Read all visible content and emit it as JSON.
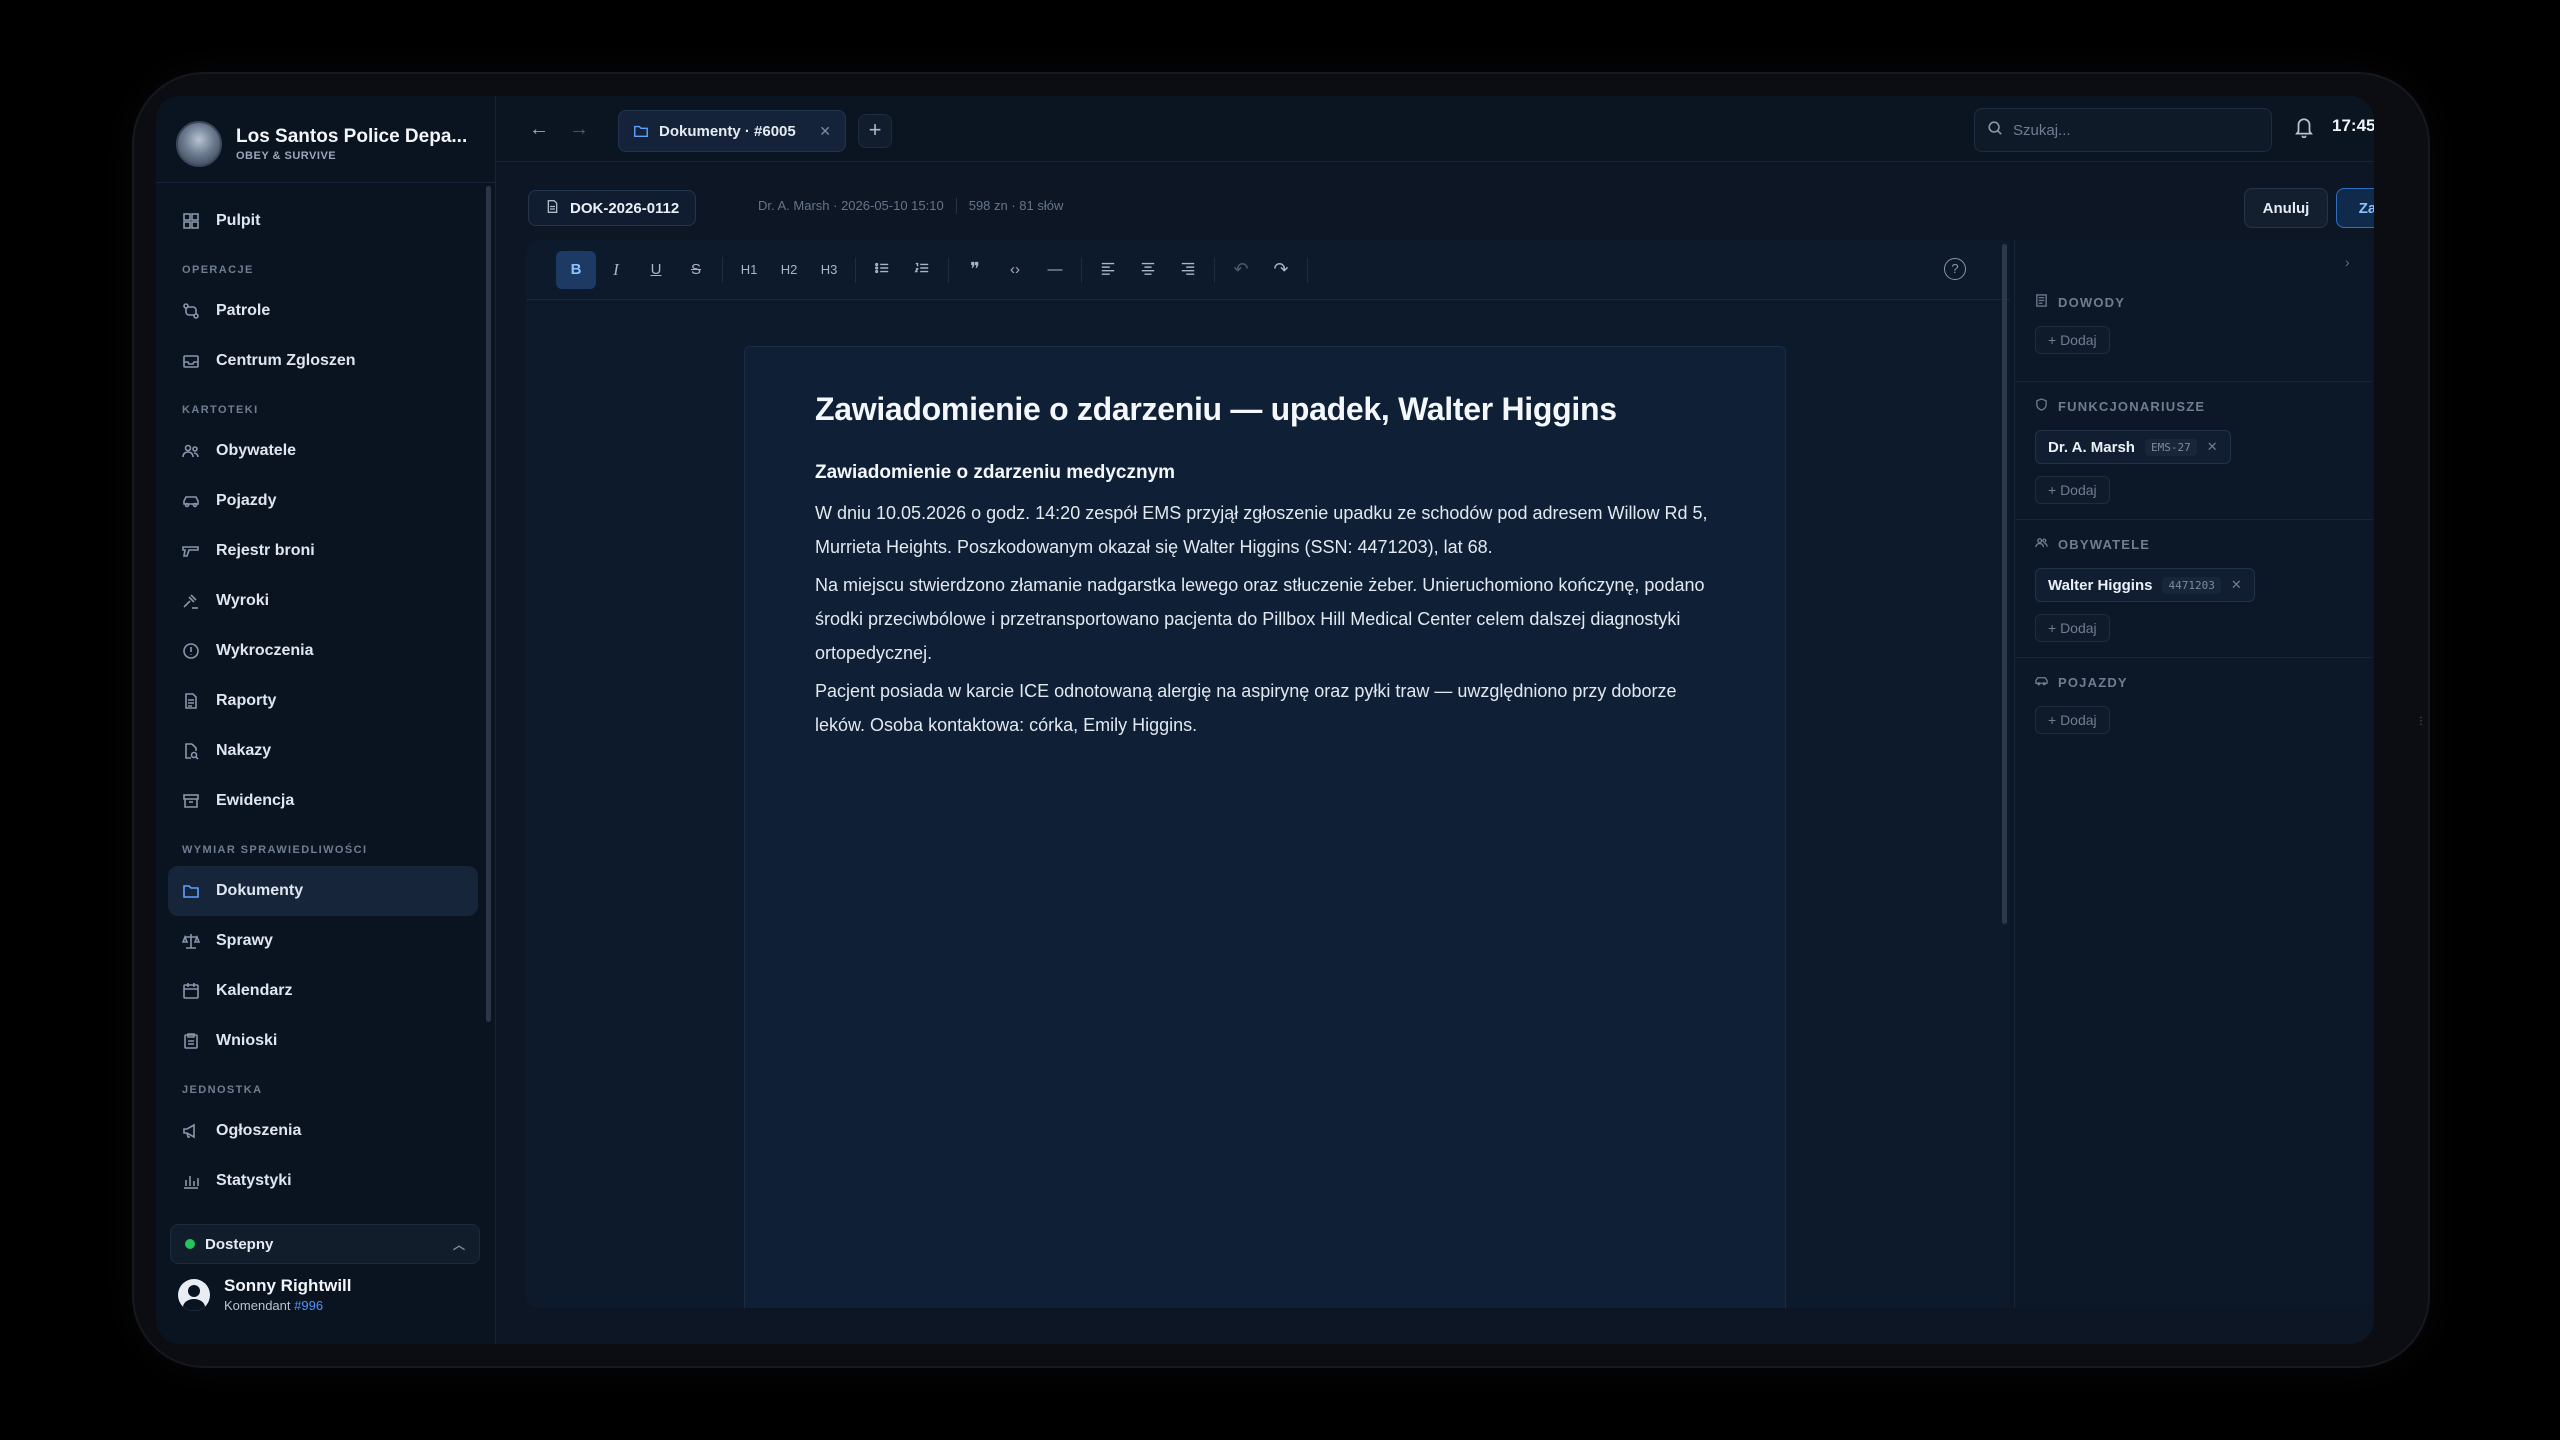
{
  "brand": {
    "title": "Los Santos Police Depa...",
    "subtitle": "OBEY & SURVIVE"
  },
  "nav": {
    "pulpit": "Pulpit",
    "section_operacje": "OPERACJE",
    "patrole": "Patrole",
    "centrum": "Centrum Zgloszen",
    "section_kartoteki": "KARTOTEKI",
    "obywatele": "Obywatele",
    "pojazdy": "Pojazdy",
    "rejestr": "Rejestr broni",
    "wyroki": "Wyroki",
    "wykroczenia": "Wykroczenia",
    "raporty": "Raporty",
    "nakazy": "Nakazy",
    "ewidencja": "Ewidencja",
    "section_wymiar": "WYMIAR SPRAWIEDLIWOŚCI",
    "dokumenty": "Dokumenty",
    "sprawy": "Sprawy",
    "kalendarz": "Kalendarz",
    "wnioski": "Wnioski",
    "section_jednostka": "JEDNOSTKA",
    "ogloszenia": "Ogłoszenia",
    "statystyki": "Statystyki"
  },
  "status": {
    "label": "Dostepny"
  },
  "user": {
    "name": "Sonny Rightwill",
    "role": "Komendant",
    "id": "#996"
  },
  "topbar": {
    "tab_label": "Dokumenty · #6005",
    "search_placeholder": "Szukaj...",
    "time": "17:45"
  },
  "document": {
    "id": "DOK-2026-0112",
    "author_date": "Dr. A. Marsh · 2026-05-10 15:10",
    "stats": "598 zn · 81 słów",
    "cancel_label": "Anuluj",
    "save_label": "Zapisz dokument",
    "title": "Zawiadomienie o zdarzeniu — upadek, Walter Higgins",
    "subtitle": "Zawiadomienie o zdarzeniu medycznym",
    "paragraphs": [
      "W dniu 10.05.2026 o godz. 14:20 zespół EMS przyjął zgłoszenie upadku ze schodów pod adresem Willow Rd 5, Murrieta Heights. Poszkodowanym okazał się Walter Higgins (SSN: 4471203), lat 68.",
      "Na miejscu stwierdzono złamanie nadgarstka lewego oraz stłuczenie żeber. Unieruchomiono kończynę, podano środki przeciwbólowe i przetransportowano pacjenta do Pillbox Hill Medical Center celem dalszej diagnostyki ortopedycznej.",
      "Pacjent posiada w karcie ICE odnotowaną alergię na aspirynę oraz pyłki traw — uwzględniono przy doborze leków. Osoba kontaktowa: córka, Emily Higgins."
    ]
  },
  "toolbar": {
    "bold": "B",
    "italic": "I",
    "underline": "U",
    "strike": "S",
    "h1": "H1",
    "h2": "H2",
    "h3": "H3",
    "quote": "❞",
    "code": "‹›",
    "hr": "—",
    "undo": "↶",
    "redo": "↷",
    "help": "?"
  },
  "panel": {
    "dowody": "DOWODY",
    "funkcjonariusze": "FUNKCJONARIUSZE",
    "obywatele": "OBYWATELE",
    "pojazdy": "POJAZDY",
    "add_label": "+ Dodaj",
    "officer_name": "Dr. A. Marsh",
    "officer_tag": "EMS-27",
    "citizen_name": "Walter Higgins",
    "citizen_tag": "4471203"
  }
}
